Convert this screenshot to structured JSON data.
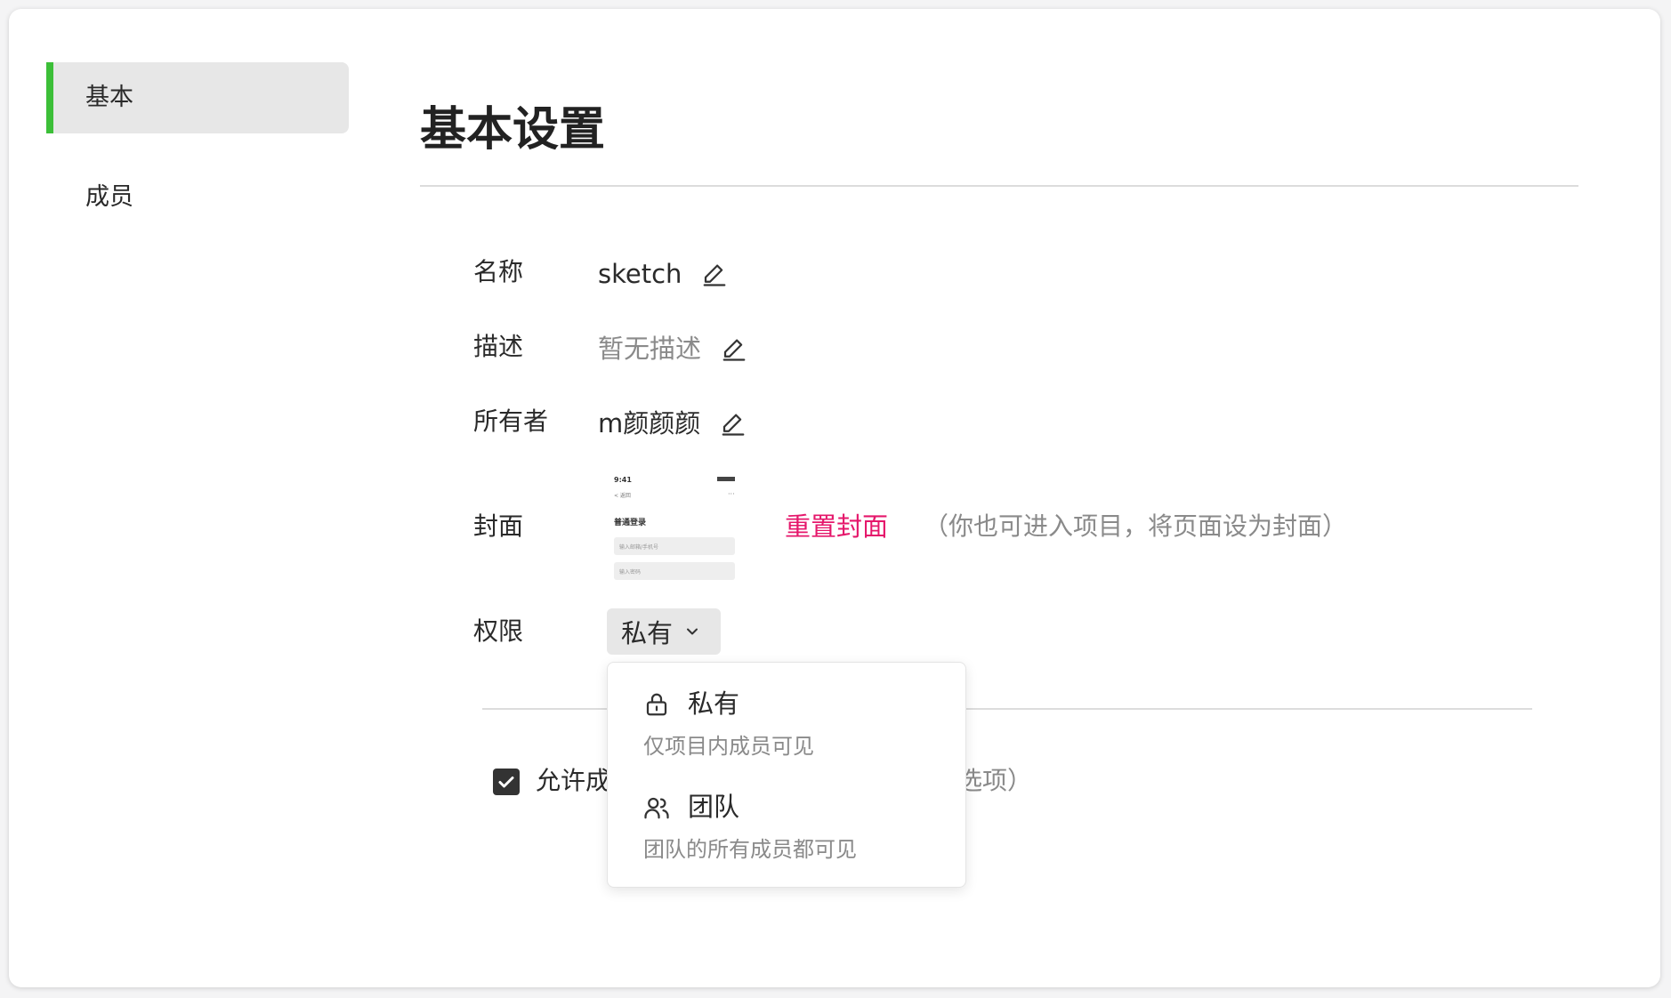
{
  "sidebar": {
    "items": [
      {
        "label": "基本",
        "active": true
      },
      {
        "label": "成员",
        "active": false
      }
    ],
    "accent_color": "#3cbf38"
  },
  "main": {
    "title": "基本设置",
    "fields": {
      "name": {
        "label": "名称",
        "value": "sketch"
      },
      "description": {
        "label": "描述",
        "value": "暂无描述"
      },
      "owner": {
        "label": "所有者",
        "value": "m颜颜颜"
      },
      "cover": {
        "label": "封面",
        "reset_label": "重置封面",
        "hint": "（你也可进入项目，将页面设为封面）",
        "thumbnail": {
          "time": "9:41",
          "back": "< 返回",
          "heading": "普通登录",
          "field1": "输入邮箱/手机号",
          "field2": "输入密码"
        }
      },
      "permission": {
        "label": "权限",
        "selected": "私有"
      }
    },
    "checkbox": {
      "checked": true,
      "label_visible": "允许成",
      "suffix_visible": "选项）"
    }
  },
  "dropdown": {
    "options": [
      {
        "icon": "lock-icon",
        "title": "私有",
        "desc": "仅项目内成员可见"
      },
      {
        "icon": "users-icon",
        "title": "团队",
        "desc": "团队的所有成员都可见"
      }
    ]
  },
  "colors": {
    "accent_green": "#3cbf38",
    "link_pink": "#e5176b",
    "muted_text": "#8a8a8a"
  }
}
